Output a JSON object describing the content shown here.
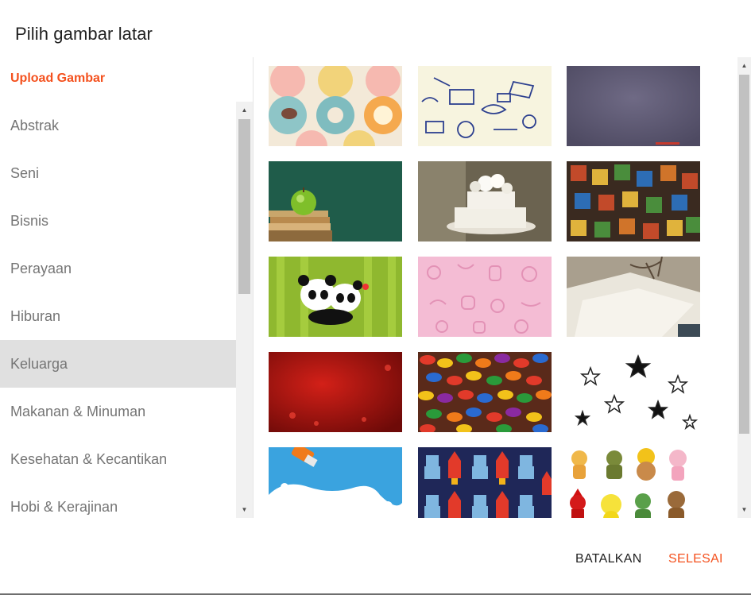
{
  "dialog": {
    "title": "Pilih gambar latar",
    "upload_label": "Upload Gambar",
    "cancel_label": "BATALKAN",
    "done_label": "SELESAI"
  },
  "categories": [
    {
      "label": "Abstrak",
      "selected": false
    },
    {
      "label": "Seni",
      "selected": false
    },
    {
      "label": "Bisnis",
      "selected": false
    },
    {
      "label": "Perayaan",
      "selected": false
    },
    {
      "label": "Hiburan",
      "selected": false
    },
    {
      "label": "Keluarga",
      "selected": true
    },
    {
      "label": "Makanan & Minuman",
      "selected": false
    },
    {
      "label": "Kesehatan & Kecantikan",
      "selected": false
    },
    {
      "label": "Hobi & Kerajinan",
      "selected": false
    }
  ],
  "images": [
    {
      "name": "floral-pattern-image"
    },
    {
      "name": "doodle-school-image"
    },
    {
      "name": "slate-chalkboard-image"
    },
    {
      "name": "apple-books-chalkboard-image"
    },
    {
      "name": "wedding-cake-image"
    },
    {
      "name": "alphabet-blocks-image"
    },
    {
      "name": "panda-couple-image"
    },
    {
      "name": "baby-pattern-image"
    },
    {
      "name": "open-books-image"
    },
    {
      "name": "red-hearts-image"
    },
    {
      "name": "jelly-beans-image"
    },
    {
      "name": "stars-pattern-image"
    },
    {
      "name": "paint-splash-image"
    },
    {
      "name": "robots-rockets-image"
    },
    {
      "name": "animal-characters-image"
    }
  ],
  "colors": {
    "accent": "#f4511e",
    "selected_bg": "#e0e0e0",
    "text_muted": "#757575"
  }
}
